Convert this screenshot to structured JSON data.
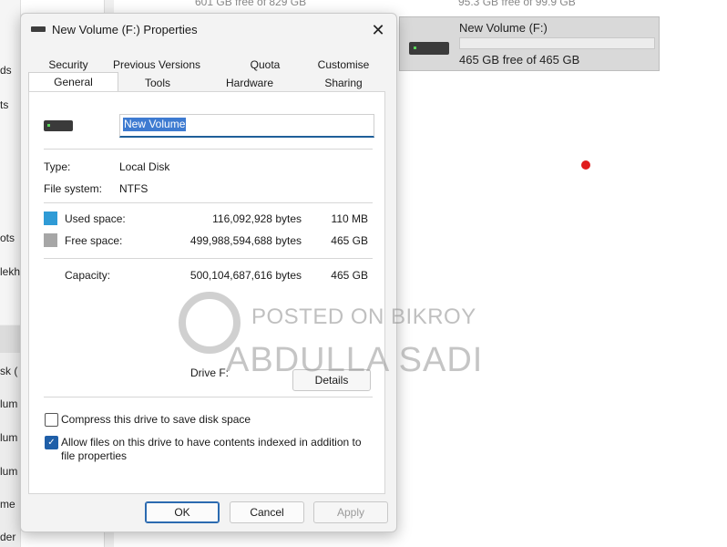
{
  "background": {
    "left_labels": [
      "ds",
      "ts",
      "ots",
      "lekh",
      "sk (",
      "lum",
      "lum",
      "lum",
      "me",
      "der"
    ],
    "top_texts": [
      "601 GB free of 829 GB",
      "95.3 GB free of 99.9 GB"
    ],
    "drive_tile": {
      "name": "New Volume (F:)",
      "free_text": "465 GB free of 465 GB",
      "usage_fraction": 0.0
    }
  },
  "dialog": {
    "title": "New Volume (F:) Properties",
    "close_glyph": "✕",
    "tabs_row1": [
      "Security",
      "Previous Versions",
      "Quota",
      "Customise"
    ],
    "tabs_row2": [
      "General",
      "Tools",
      "Hardware",
      "Sharing"
    ],
    "active_tab": "General",
    "volume_name": "New Volume",
    "type_label": "Type:",
    "type_value": "Local Disk",
    "fs_label": "File system:",
    "fs_value": "NTFS",
    "used_label": "Used space:",
    "used_bytes": "116,092,928 bytes",
    "used_size": "110 MB",
    "free_label": "Free space:",
    "free_bytes": "499,988,594,688 bytes",
    "free_size": "465 GB",
    "capacity_label": "Capacity:",
    "capacity_bytes": "500,104,687,616 bytes",
    "capacity_size": "465 GB",
    "drive_label": "Drive F:",
    "details_button": "Details",
    "compress_label": "Compress this drive to save disk space",
    "compress_checked": false,
    "index_label_1": "Allow files on this drive to have contents indexed in addition to",
    "index_label_2": "file properties",
    "index_checked": true,
    "ok_button": "OK",
    "cancel_button": "Cancel",
    "apply_button": "Apply"
  },
  "colors": {
    "used": "#2f9bd6",
    "free": "#a6a6a6",
    "accent": "#1f5fa8"
  },
  "watermark": {
    "line1": "POSTED ON BIKROY",
    "line2": "ABDULLA SADI"
  }
}
